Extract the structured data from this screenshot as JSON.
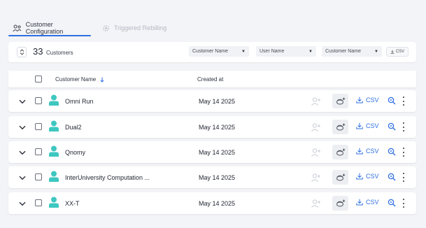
{
  "tabs": [
    {
      "label": "Customer Configuration",
      "active": true,
      "icon": "users-gear-icon"
    },
    {
      "label": "Triggered Rebilling",
      "active": false,
      "icon": "gear-icon"
    }
  ],
  "toolbar": {
    "count": "33",
    "count_label": "Customers",
    "filters": [
      {
        "label": "Customer Name"
      },
      {
        "label": "User Name"
      },
      {
        "label": "Customer Name"
      }
    ],
    "csv_label": "CSV"
  },
  "table": {
    "columns": {
      "name": "Customer Name",
      "created": "Created at"
    },
    "rows": [
      {
        "name": "Omni Run",
        "created": "May 14 2025",
        "csv": "CSV"
      },
      {
        "name": "Dual2",
        "created": "May 14 2025",
        "csv": "CSV"
      },
      {
        "name": "Qnomy",
        "created": "May 14 2025",
        "csv": "CSV"
      },
      {
        "name": "InterUniversity Computation ...",
        "created": "May 14 2025",
        "csv": "CSV"
      },
      {
        "name": "XX-T",
        "created": "May 14 2025",
        "csv": "CSV"
      }
    ]
  },
  "colors": {
    "accent": "#2f6fe0",
    "avatar": "#3ec7c0",
    "background": "#f3f4f7"
  }
}
